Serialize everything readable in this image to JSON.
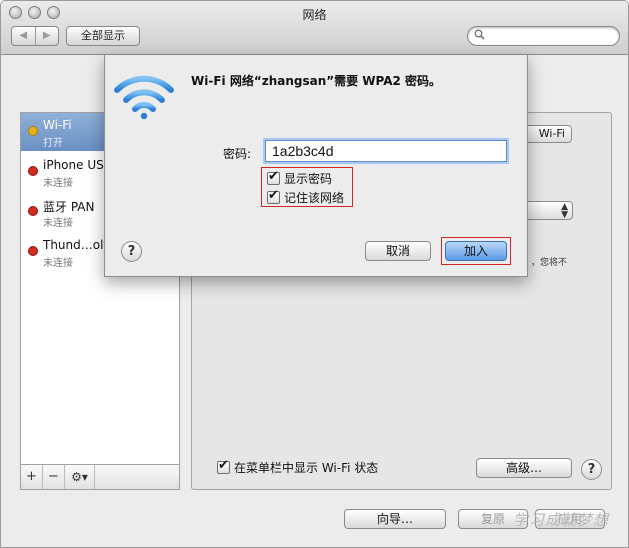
{
  "window": {
    "title": "网络"
  },
  "toolbar": {
    "back_glyph": "◀",
    "forward_glyph": "▶",
    "show_all_label": "全部显示",
    "search_placeholder": ""
  },
  "sidebar": {
    "items": [
      {
        "name": "Wi-Fi",
        "status": "打开",
        "dot_color": "#e8b21c",
        "selected": true
      },
      {
        "name": "iPhone USB",
        "status": "未连接",
        "dot_color": "#d42a22",
        "selected": false
      },
      {
        "name": "蓝牙 PAN",
        "status": "未连接",
        "dot_color": "#d42a22",
        "selected": false
      },
      {
        "name": "Thund…olt",
        "status": "未连接",
        "dot_color": "#d42a22",
        "selected": false
      }
    ],
    "tools": {
      "add": "+",
      "remove": "−",
      "gear": "⚙▾"
    }
  },
  "panel": {
    "wifi_button_label": "Wi-Fi",
    "partial_text": "，您将不",
    "menubar_checkbox_label": "在菜单栏中显示 Wi-Fi 状态",
    "menubar_checked": true,
    "advanced_label": "高级…",
    "help_glyph": "?"
  },
  "footer": {
    "assistant_label": "向导…",
    "revert_label": "复原",
    "apply_label": "应用",
    "watermark": "学习成就梦想"
  },
  "sheet": {
    "title": "Wi-Fi 网络“zhangsan”需要 WPA2 密码。",
    "password_label": "密码:",
    "password_value": "1a2b3c4d",
    "show_password_label": "显示密码",
    "show_password_checked": true,
    "remember_label": "记住该网络",
    "remember_checked": true,
    "cancel_label": "取消",
    "join_label": "加入",
    "help_glyph": "?"
  },
  "colors": {
    "selection": "#7fa2d0",
    "annotation_red": "#d0262a",
    "join_blue": "#5d9be6"
  }
}
